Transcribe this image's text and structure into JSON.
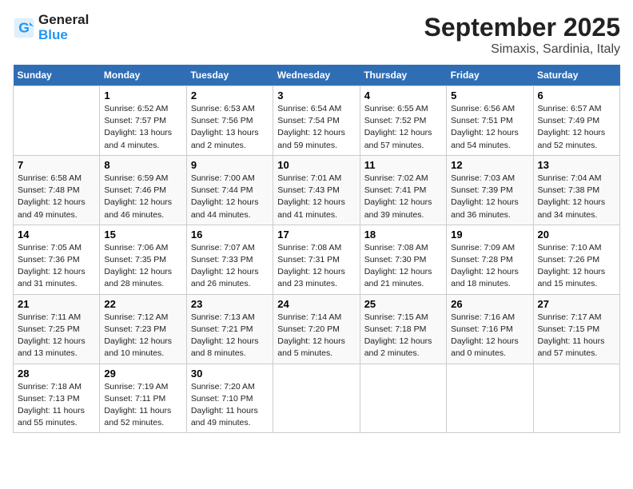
{
  "header": {
    "logo_line1": "General",
    "logo_line2": "Blue",
    "month": "September 2025",
    "location": "Simaxis, Sardinia, Italy"
  },
  "weekdays": [
    "Sunday",
    "Monday",
    "Tuesday",
    "Wednesday",
    "Thursday",
    "Friday",
    "Saturday"
  ],
  "weeks": [
    [
      {
        "day": "",
        "sunrise": "",
        "sunset": "",
        "daylight": "",
        "empty": true
      },
      {
        "day": "1",
        "sunrise": "Sunrise: 6:52 AM",
        "sunset": "Sunset: 7:57 PM",
        "daylight": "Daylight: 13 hours and 4 minutes."
      },
      {
        "day": "2",
        "sunrise": "Sunrise: 6:53 AM",
        "sunset": "Sunset: 7:56 PM",
        "daylight": "Daylight: 13 hours and 2 minutes."
      },
      {
        "day": "3",
        "sunrise": "Sunrise: 6:54 AM",
        "sunset": "Sunset: 7:54 PM",
        "daylight": "Daylight: 12 hours and 59 minutes."
      },
      {
        "day": "4",
        "sunrise": "Sunrise: 6:55 AM",
        "sunset": "Sunset: 7:52 PM",
        "daylight": "Daylight: 12 hours and 57 minutes."
      },
      {
        "day": "5",
        "sunrise": "Sunrise: 6:56 AM",
        "sunset": "Sunset: 7:51 PM",
        "daylight": "Daylight: 12 hours and 54 minutes."
      },
      {
        "day": "6",
        "sunrise": "Sunrise: 6:57 AM",
        "sunset": "Sunset: 7:49 PM",
        "daylight": "Daylight: 12 hours and 52 minutes."
      }
    ],
    [
      {
        "day": "7",
        "sunrise": "Sunrise: 6:58 AM",
        "sunset": "Sunset: 7:48 PM",
        "daylight": "Daylight: 12 hours and 49 minutes."
      },
      {
        "day": "8",
        "sunrise": "Sunrise: 6:59 AM",
        "sunset": "Sunset: 7:46 PM",
        "daylight": "Daylight: 12 hours and 46 minutes."
      },
      {
        "day": "9",
        "sunrise": "Sunrise: 7:00 AM",
        "sunset": "Sunset: 7:44 PM",
        "daylight": "Daylight: 12 hours and 44 minutes."
      },
      {
        "day": "10",
        "sunrise": "Sunrise: 7:01 AM",
        "sunset": "Sunset: 7:43 PM",
        "daylight": "Daylight: 12 hours and 41 minutes."
      },
      {
        "day": "11",
        "sunrise": "Sunrise: 7:02 AM",
        "sunset": "Sunset: 7:41 PM",
        "daylight": "Daylight: 12 hours and 39 minutes."
      },
      {
        "day": "12",
        "sunrise": "Sunrise: 7:03 AM",
        "sunset": "Sunset: 7:39 PM",
        "daylight": "Daylight: 12 hours and 36 minutes."
      },
      {
        "day": "13",
        "sunrise": "Sunrise: 7:04 AM",
        "sunset": "Sunset: 7:38 PM",
        "daylight": "Daylight: 12 hours and 34 minutes."
      }
    ],
    [
      {
        "day": "14",
        "sunrise": "Sunrise: 7:05 AM",
        "sunset": "Sunset: 7:36 PM",
        "daylight": "Daylight: 12 hours and 31 minutes."
      },
      {
        "day": "15",
        "sunrise": "Sunrise: 7:06 AM",
        "sunset": "Sunset: 7:35 PM",
        "daylight": "Daylight: 12 hours and 28 minutes."
      },
      {
        "day": "16",
        "sunrise": "Sunrise: 7:07 AM",
        "sunset": "Sunset: 7:33 PM",
        "daylight": "Daylight: 12 hours and 26 minutes."
      },
      {
        "day": "17",
        "sunrise": "Sunrise: 7:08 AM",
        "sunset": "Sunset: 7:31 PM",
        "daylight": "Daylight: 12 hours and 23 minutes."
      },
      {
        "day": "18",
        "sunrise": "Sunrise: 7:08 AM",
        "sunset": "Sunset: 7:30 PM",
        "daylight": "Daylight: 12 hours and 21 minutes."
      },
      {
        "day": "19",
        "sunrise": "Sunrise: 7:09 AM",
        "sunset": "Sunset: 7:28 PM",
        "daylight": "Daylight: 12 hours and 18 minutes."
      },
      {
        "day": "20",
        "sunrise": "Sunrise: 7:10 AM",
        "sunset": "Sunset: 7:26 PM",
        "daylight": "Daylight: 12 hours and 15 minutes."
      }
    ],
    [
      {
        "day": "21",
        "sunrise": "Sunrise: 7:11 AM",
        "sunset": "Sunset: 7:25 PM",
        "daylight": "Daylight: 12 hours and 13 minutes."
      },
      {
        "day": "22",
        "sunrise": "Sunrise: 7:12 AM",
        "sunset": "Sunset: 7:23 PM",
        "daylight": "Daylight: 12 hours and 10 minutes."
      },
      {
        "day": "23",
        "sunrise": "Sunrise: 7:13 AM",
        "sunset": "Sunset: 7:21 PM",
        "daylight": "Daylight: 12 hours and 8 minutes."
      },
      {
        "day": "24",
        "sunrise": "Sunrise: 7:14 AM",
        "sunset": "Sunset: 7:20 PM",
        "daylight": "Daylight: 12 hours and 5 minutes."
      },
      {
        "day": "25",
        "sunrise": "Sunrise: 7:15 AM",
        "sunset": "Sunset: 7:18 PM",
        "daylight": "Daylight: 12 hours and 2 minutes."
      },
      {
        "day": "26",
        "sunrise": "Sunrise: 7:16 AM",
        "sunset": "Sunset: 7:16 PM",
        "daylight": "Daylight: 12 hours and 0 minutes."
      },
      {
        "day": "27",
        "sunrise": "Sunrise: 7:17 AM",
        "sunset": "Sunset: 7:15 PM",
        "daylight": "Daylight: 11 hours and 57 minutes."
      }
    ],
    [
      {
        "day": "28",
        "sunrise": "Sunrise: 7:18 AM",
        "sunset": "Sunset: 7:13 PM",
        "daylight": "Daylight: 11 hours and 55 minutes."
      },
      {
        "day": "29",
        "sunrise": "Sunrise: 7:19 AM",
        "sunset": "Sunset: 7:11 PM",
        "daylight": "Daylight: 11 hours and 52 minutes."
      },
      {
        "day": "30",
        "sunrise": "Sunrise: 7:20 AM",
        "sunset": "Sunset: 7:10 PM",
        "daylight": "Daylight: 11 hours and 49 minutes."
      },
      {
        "day": "",
        "sunrise": "",
        "sunset": "",
        "daylight": "",
        "empty": true
      },
      {
        "day": "",
        "sunrise": "",
        "sunset": "",
        "daylight": "",
        "empty": true
      },
      {
        "day": "",
        "sunrise": "",
        "sunset": "",
        "daylight": "",
        "empty": true
      },
      {
        "day": "",
        "sunrise": "",
        "sunset": "",
        "daylight": "",
        "empty": true
      }
    ]
  ]
}
